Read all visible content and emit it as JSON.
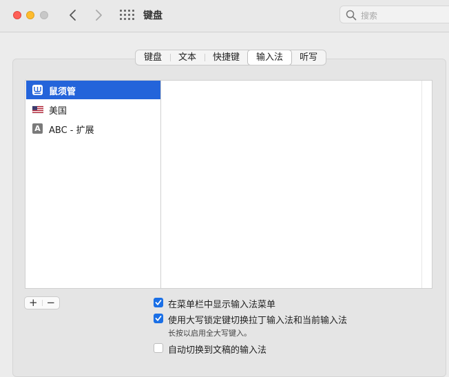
{
  "window": {
    "title": "键盘",
    "search_placeholder": "搜索"
  },
  "tabs": [
    {
      "label": "键盘",
      "active": false
    },
    {
      "label": "文本",
      "active": false
    },
    {
      "label": "快捷键",
      "active": false
    },
    {
      "label": "输入法",
      "active": true
    },
    {
      "label": "听写",
      "active": false
    }
  ],
  "input_sources": [
    {
      "label": "鼠须管",
      "icon": "rime-icon",
      "selected": true
    },
    {
      "label": "美国",
      "icon": "us-flag-icon",
      "selected": false
    },
    {
      "label": "ABC - 扩展",
      "icon": "abc-extended-icon",
      "icon_text": "A",
      "selected": false
    }
  ],
  "list_controls": {
    "add": "+",
    "remove": "−"
  },
  "options": [
    {
      "label": "在菜单栏中显示输入法菜单",
      "checked": true
    },
    {
      "label": "使用大写锁定键切换拉丁输入法和当前输入法",
      "checked": true,
      "note": "长按以启用全大写键入。"
    },
    {
      "label": "自动切换到文稿的输入法",
      "checked": false
    }
  ],
  "colors": {
    "selection": "#2464da",
    "checkbox_on": "#1a6fe6",
    "close": "#fe5f57",
    "minimize": "#febc2e"
  }
}
